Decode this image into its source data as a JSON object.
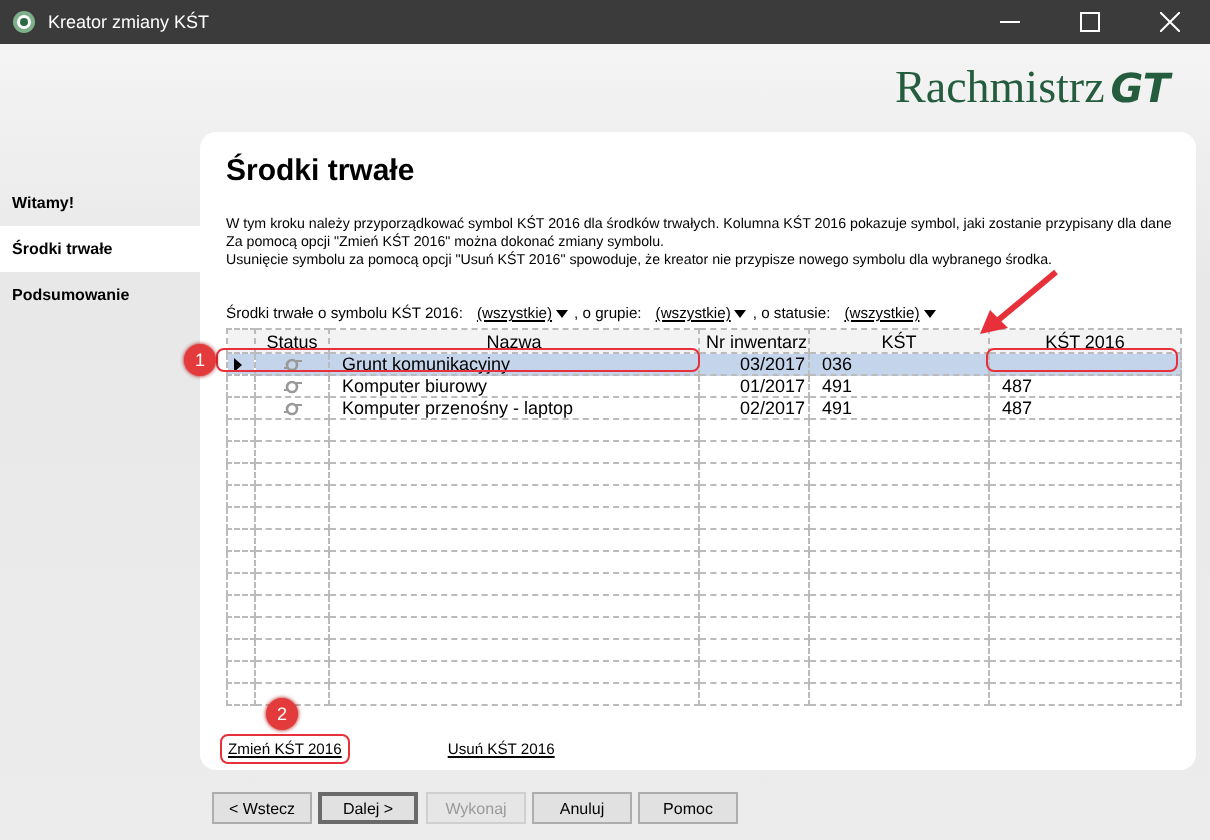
{
  "window": {
    "title": "Kreator zmiany KŚT"
  },
  "logo": {
    "text": "Rachmistrz",
    "mark": "GT"
  },
  "sidebar": {
    "items": [
      {
        "label": "Witamy!",
        "selected": false
      },
      {
        "label": "Środki trwałe",
        "selected": true
      },
      {
        "label": "Podsumowanie",
        "selected": false
      }
    ]
  },
  "page": {
    "title": "Środki trwałe",
    "description": [
      "W tym kroku należy przyporządkować symbol KŚT 2016 dla środków trwałych. Kolumna KŚT 2016 pokazuje symbol, jaki zostanie przypisany dla dane",
      "Za pomocą opcji \"Zmień KŚT 2016\" można dokonać zmiany symbolu.",
      "Usunięcie symbolu za pomocą opcji \"Usuń KŚT 2016\" spowoduje, że kreator nie przypisze nowego symbolu dla wybranego środka."
    ]
  },
  "filters": [
    {
      "label": "Środki trwałe o symbolu KŚT 2016:",
      "value": "(wszystkie)"
    },
    {
      "label": ", o grupie:",
      "value": "(wszystkie)"
    },
    {
      "label": ", o statusie:",
      "value": "(wszystkie)"
    }
  ],
  "table": {
    "columns": [
      "Status",
      "Nazwa",
      "Nr inwentarz",
      "KŚT",
      "KŚT 2016"
    ],
    "rows": [
      {
        "selected": true,
        "annotated": true,
        "callout": "1",
        "cells": [
          "",
          "Grunt komunikacyjny",
          "03/2017",
          "036",
          ""
        ]
      },
      {
        "selected": false,
        "annotated": false,
        "cells": [
          "",
          "Komputer biurowy",
          "01/2017",
          "491",
          "487"
        ]
      },
      {
        "selected": false,
        "annotated": false,
        "cells": [
          "",
          "Komputer przenośny - laptop",
          "02/2017",
          "491",
          "487"
        ]
      }
    ]
  },
  "links": [
    {
      "label": "Zmień KŚT 2016",
      "annotated": true,
      "callout": "2"
    },
    {
      "label": "Usuń KŚT 2016",
      "annotated": false
    }
  ],
  "buttons": [
    {
      "label": "< Wstecz",
      "disabled": false,
      "default": false
    },
    {
      "label": "Dalej >",
      "disabled": false,
      "default": true
    },
    {
      "label": "Wykonaj",
      "disabled": true,
      "default": false
    },
    {
      "label": "Anuluj",
      "disabled": false,
      "default": false
    },
    {
      "label": "Pomoc",
      "disabled": false,
      "default": false
    }
  ]
}
